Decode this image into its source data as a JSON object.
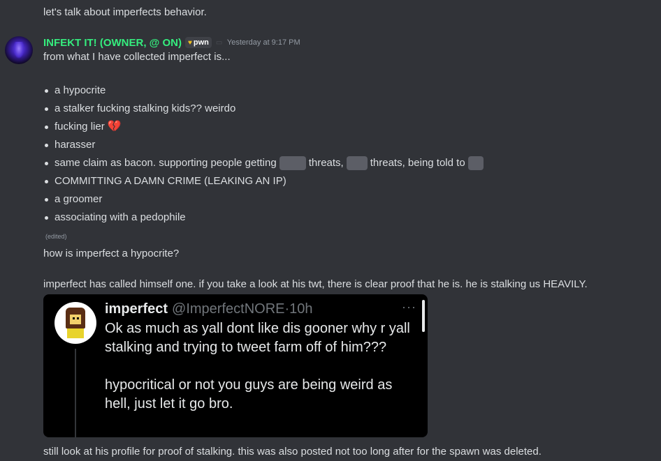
{
  "previous_message": "let's talk about imperfects behavior.",
  "message": {
    "username": "INFEKT IT! (OWNER, @ ON)",
    "tag": "pwn",
    "timestamp": "Yesterday at 9:17 PM",
    "intro": "from what I have collected imperfect is...",
    "bullets": {
      "b1": "a hypocrite",
      "b2": "a stalker fucking stalking kids?? weirdo",
      "b3": "fucking lier",
      "b4": "harasser",
      "b5_a": "same claim as bacon. supporting people getting",
      "b5_b": "threats,",
      "b5_c": "threats, being told to",
      "b6": "COMMITTING A DAMN CRIME (LEAKING AN IP)",
      "b7": "a groomer",
      "b8": "associating with a pedophile"
    },
    "edited": "(edited)"
  },
  "follow": {
    "question": "how is imperfect a hypocrite?",
    "explanation": "imperfect has called himself one. if you take a look at his twt, there is clear proof that he is. he is stalking us HEAVILY.",
    "footer": "still look at his profile for proof of stalking. this was also posted not too long after for the spawn was deleted."
  },
  "tweet": {
    "name": "imperfect",
    "handle": "@ImperfectNORE",
    "dot": "·",
    "time": "10h",
    "more": "···",
    "para1": "Ok as much as yall dont like dis gooner why r yall stalking and trying to tweet farm off of him???",
    "para2": "hypocritical or not you guys are being weird as hell, just let it go bro."
  },
  "icons": {
    "heart": "broken-heart-emoji",
    "tag_badge": "badge-icon"
  },
  "colors": {
    "background": "#313338",
    "username": "#35ed7e",
    "text": "#dbdee1",
    "spoiler": "#5c5e66",
    "embed_bg": "#000000"
  }
}
